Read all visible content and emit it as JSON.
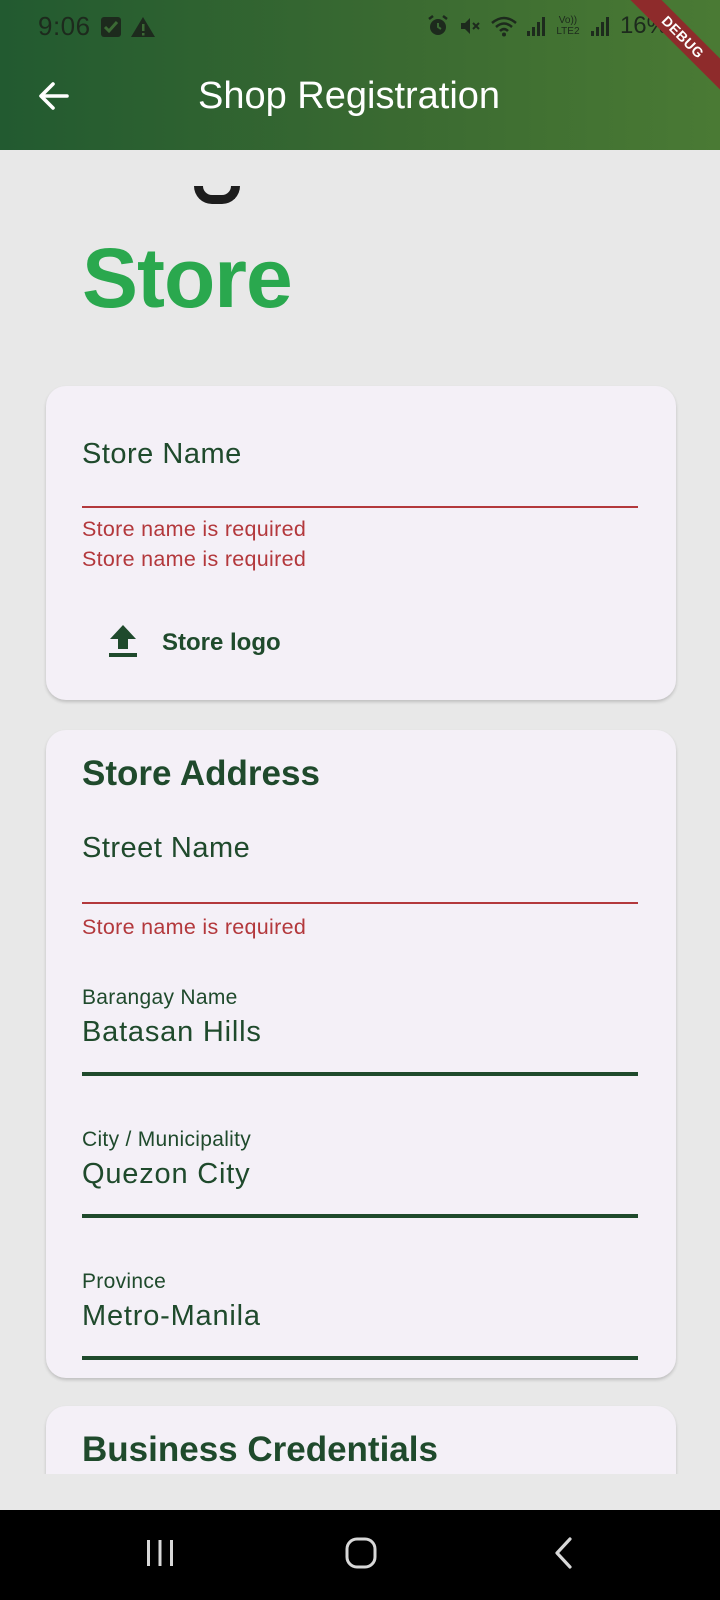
{
  "status_bar": {
    "time": "9:06",
    "battery": "16%",
    "network_label": "Vo)) LTE2",
    "left_icons": [
      "check-square-icon",
      "warning-icon"
    ],
    "right_icons": [
      "alarm-icon",
      "mute-icon",
      "wifi-icon",
      "signal-icon",
      "signal-icon",
      "battery-icon"
    ]
  },
  "debug_banner": "DEBUG",
  "app_bar": {
    "title": "Shop Registration",
    "back_icon": "arrow-left-icon"
  },
  "hero": {
    "title": "Store"
  },
  "store_card": {
    "store_name_label": "Store Name",
    "errors": [
      "Store name is required",
      "Store name is required"
    ],
    "logo_button_label": "Store logo",
    "logo_icon": "upload-icon"
  },
  "address_card": {
    "title": "Store Address",
    "street": {
      "label": "Street Name",
      "error": "Store name is required"
    },
    "barangay": {
      "label": "Barangay Name",
      "value": "Batasan Hills"
    },
    "city": {
      "label": "City / Municipality",
      "value": "Quezon City"
    },
    "province": {
      "label": "Province",
      "value": "Metro-Manila"
    }
  },
  "credentials_card": {
    "title": "Business Credentials"
  },
  "colors": {
    "header_start": "#225a30",
    "header_end": "#4a7a34",
    "accent_green": "#2aa84e",
    "text_dark_green": "#1f4a2c",
    "error_red": "#b3383c",
    "card_bg": "#f4f0f7",
    "page_bg": "#e8e8e8"
  },
  "nav_bar": {
    "icons": [
      "recent-apps-icon",
      "home-icon",
      "back-icon"
    ]
  }
}
